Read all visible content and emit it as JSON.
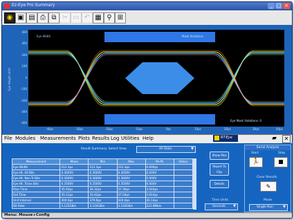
{
  "window": {
    "title": "Ez-Eye Pro Summary",
    "controls": {
      "minimize": "_",
      "maximize": "□",
      "close": "×"
    },
    "title_colors": {
      "close": "#e8594a",
      "min": "#6b93dc"
    }
  },
  "toolbar": {
    "icons": [
      "eye-icon",
      "save-icon",
      "open-folder-icon",
      "print-icon",
      "copy-icon",
      "cut-icon",
      "paste-icon",
      "undo-icon",
      "chart-icon",
      "filter-icon",
      "grid-icon"
    ]
  },
  "plot": {
    "ylabel": "Eye Height (mV)",
    "left_label": "Eye Width",
    "top_right_label": "Mask Violations",
    "bottom_right_label": "Eye Mask Violations: 0",
    "yticks": [
      "400",
      "300",
      "200",
      "100",
      "0",
      "-100",
      "-200",
      "-300",
      "-400"
    ],
    "xticks": [
      "-40ps",
      "-30ps",
      "-20ps",
      "-10ps",
      "0ps",
      "10ps",
      "20ps",
      "30ps",
      "40ps"
    ],
    "colors": {
      "eye": "#e6d22a",
      "eye2": "#4bc2ff",
      "mask": "#2f77e6",
      "hex": "#3c8de8",
      "background": "#000000"
    }
  },
  "menubar": {
    "items": [
      "File",
      "Modules",
      "Measurements",
      "Plots",
      "Results",
      "Log",
      "Utilities",
      "Help"
    ],
    "logo_text": "RT-Eye"
  },
  "results": {
    "header_label": "Result Summary: Select View",
    "view_value": "All Stats",
    "columns": [
      "Measurement",
      "Mean",
      "Min",
      "Max",
      "Pk-Pk",
      "Status"
    ],
    "rows": [
      [
        "Eye Width",
        "212.3ps",
        "212.3ps",
        "212.3ps",
        "0.000ps",
        ""
      ],
      [
        "Eye Ht. All Bits",
        "0.3600V",
        "0.3600V",
        "0.3600V",
        "0.000V",
        ""
      ],
      [
        "Eye Ht. Non-Tr Bits",
        "0.3600V",
        "0.3600V",
        "0.3600V",
        "0.000V",
        ""
      ],
      [
        "Eye Ht. Trans Bits",
        "0.3500V",
        "0.3500V",
        "0.3500V",
        "0.000V",
        ""
      ],
      [
        "Rise Time",
        "35.93ps",
        "34.32ps",
        "37.36ps",
        "3.044ps",
        ""
      ],
      [
        "Fall Time",
        "35.11ps",
        "33.42ps",
        "37.04ps",
        "3.614ps",
        ""
      ],
      [
        "Unit Interval",
        "400.0ps",
        "379.9ps",
        "420.0ps",
        "40.14ps",
        ""
      ],
      [
        "Bit Rate",
        "3.125GB/s",
        "3.124GB/s",
        "3.126GB/s",
        "222.8Mb/s",
        ""
      ]
    ]
  },
  "side": {
    "show_plot": "Show Plot",
    "report": "Report To Clip",
    "details": "Details",
    "time_units_label": "Time Units",
    "time_units_value": "Seconds"
  },
  "serial": {
    "title": "Serial Analysis",
    "start": "Start",
    "stop": "Stop",
    "clear_results": "Clear Results",
    "mode_label": "Mode",
    "mode_value": "Single Run"
  },
  "status": "Menu: Mouse+Config"
}
